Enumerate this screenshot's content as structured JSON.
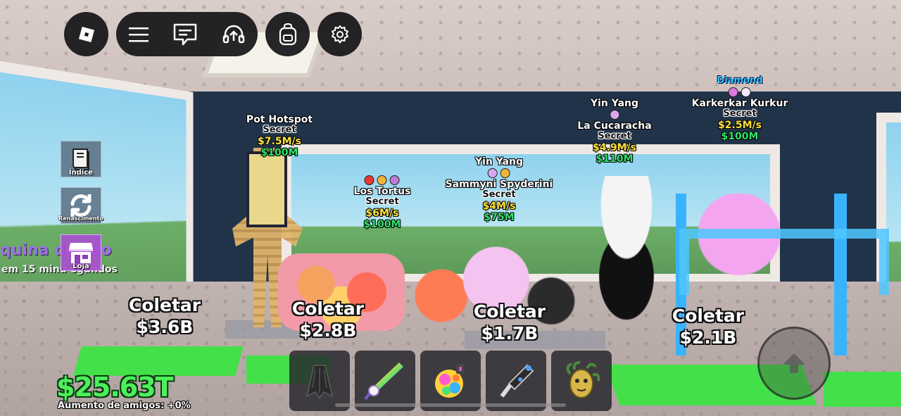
{
  "topbar": {
    "roblox_icon": "roblox-logo-icon",
    "menu_icon": "hamburger-menu-icon",
    "chat_icon": "chat-icon",
    "voice_icon": "headset-icon",
    "backpack_icon": "backpack-icon",
    "settings_icon": "gear-icon"
  },
  "sidebar": {
    "items": [
      {
        "label": "Índice",
        "icon": "book-icon"
      },
      {
        "label": "Renascimento",
        "icon": "rebirth-arrows-icon"
      },
      {
        "label": "Loja",
        "icon": "shop-icon"
      }
    ]
  },
  "shop_sign": {
    "title": "quina de  ção",
    "subtitle": "em 15 minu    egundos"
  },
  "brainrots": [
    {
      "name": "Pot Hotspot",
      "rarity": "Secret",
      "rate": "$7.5M/s",
      "price": "$100M"
    },
    {
      "name": "Los Tortus",
      "rarity": "Secret",
      "rate": "$6M/s",
      "price": "$100M"
    },
    {
      "mutation": "Yin Yang",
      "name": "Sammyni Spyderini",
      "rarity": "Secret",
      "rate": "$4M/s",
      "price": "$75M"
    },
    {
      "mutation": "Yin Yang",
      "name": "La Cucaracha",
      "rarity": "Secret",
      "rate": "$4.9M/s",
      "price": "$110M"
    },
    {
      "mutation": "Diamond",
      "name": "Karkerkar Kurkur",
      "rarity": "Secret",
      "rate": "$2.5M/s",
      "price": "$100M"
    }
  ],
  "collect": [
    {
      "label": "Coletar",
      "amount": "$3.6B"
    },
    {
      "label": "Coletar",
      "amount": "$2.8B"
    },
    {
      "label": "Coletar",
      "amount": "$1.7B"
    },
    {
      "label": "Coletar",
      "amount": "$2.1B"
    }
  ],
  "hud": {
    "money": "$25.63T",
    "friends_boost": "Aumento de amigos: +0%"
  },
  "hotbar": {
    "slots": [
      "cape-icon",
      "unicorn-sword-icon",
      "disco-grenade-icon",
      "grapple-gun-icon",
      "medusa-mask-icon"
    ]
  },
  "controls": {
    "jump_icon": "jump-arrow-icon"
  },
  "colors": {
    "money": "#4df05a",
    "rate": "#ffe23a",
    "price": "#33e26a",
    "pad": "#44e04a",
    "hud_button": "#141416"
  }
}
